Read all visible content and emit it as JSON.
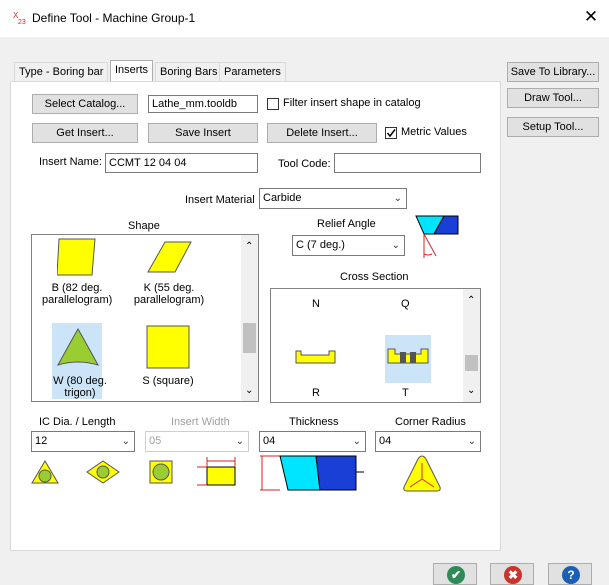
{
  "window": {
    "title": "Define Tool - Machine Group-1",
    "close_symbol": "✕"
  },
  "tabs": [
    {
      "label": "Type - Boring bar"
    },
    {
      "label": "Inserts"
    },
    {
      "label": "Boring Bars"
    },
    {
      "label": "Parameters"
    }
  ],
  "side_buttons": {
    "save_to_library": "Save To Library...",
    "draw_tool": "Draw Tool...",
    "setup_tool": "Setup Tool..."
  },
  "top": {
    "select_catalog": "Select Catalog...",
    "catalog_file": "Lathe_mm.tooldb",
    "filter_label": "Filter insert shape in catalog",
    "filter_checked": false,
    "get_insert": "Get Insert...",
    "save_insert": "Save Insert",
    "delete_insert": "Delete Insert...",
    "metric_label": "Metric Values",
    "metric_checked": true,
    "insert_name_label": "Insert Name:",
    "insert_name_value": "CCMT 12 04 04",
    "tool_code_label": "Tool Code:",
    "tool_code_value": "",
    "insert_material_label": "Insert Material",
    "insert_material_value": "Carbide"
  },
  "shape": {
    "heading": "Shape",
    "items": [
      {
        "caption": "B (82 deg.\nparallelogram)"
      },
      {
        "caption": "K (55 deg.\nparallelogram)"
      },
      {
        "caption": "W (80 deg.\ntrigon)"
      },
      {
        "caption": "S (square)"
      }
    ]
  },
  "relief": {
    "heading": "Relief Angle",
    "value": "C (7 deg.)"
  },
  "cross_section": {
    "heading": "Cross Section",
    "labels": [
      "N",
      "Q",
      "R",
      "T"
    ]
  },
  "dims": {
    "ic_label": "IC Dia. / Length",
    "ic_value": "12",
    "width_label": "Insert Width",
    "width_value": "05",
    "thickness_label": "Thickness",
    "thickness_value": "04",
    "corner_label": "Corner Radius",
    "corner_value": "04"
  },
  "colors": {
    "accent": "#0078d7",
    "insert_yellow": "#ffff00",
    "selection": "#cce4f7",
    "ok_green": "#2e8b57",
    "cancel_red": "#c9342b",
    "help_blue": "#1a5fb4"
  },
  "footer_icons": [
    "check-icon",
    "cancel-icon",
    "help-icon"
  ]
}
